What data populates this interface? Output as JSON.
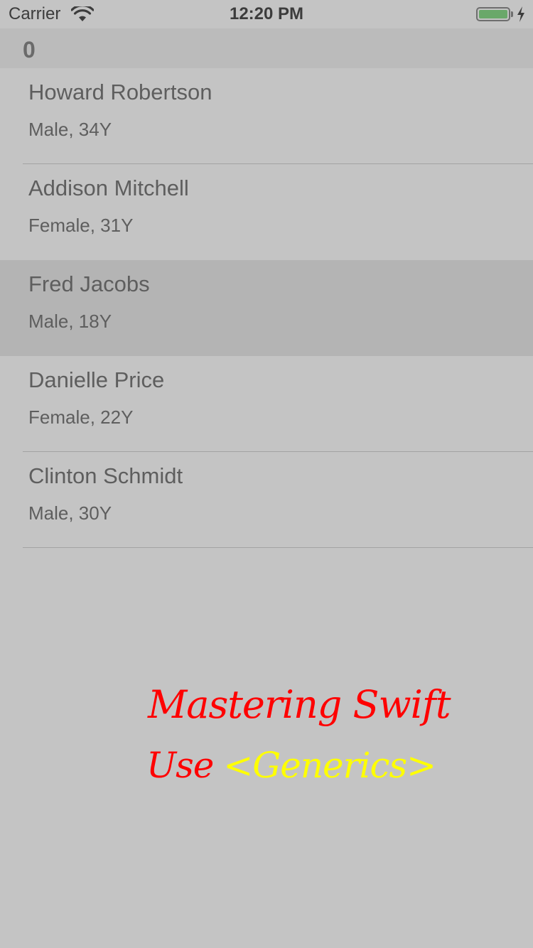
{
  "status_bar": {
    "carrier": "Carrier",
    "time": "12:20 PM",
    "battery_level": 1.0,
    "battery_color": "#6aa86a",
    "charging": true
  },
  "section": {
    "title": "0"
  },
  "people": [
    {
      "name": "Howard Robertson",
      "detail": "Male, 34Y",
      "selected": false
    },
    {
      "name": "Addison Mitchell",
      "detail": "Female, 31Y",
      "selected": false
    },
    {
      "name": "Fred Jacobs",
      "detail": "Male, 18Y",
      "selected": true
    },
    {
      "name": "Danielle Price",
      "detail": "Female, 22Y",
      "selected": false
    },
    {
      "name": "Clinton Schmidt",
      "detail": "Male, 30Y",
      "selected": false
    }
  ],
  "banner": {
    "line1": "Mastering Swift",
    "line2_prefix": "Use",
    "line2_highlight": "<Generics>",
    "line1_color": "#ff0000",
    "highlight_color": "#ffff00"
  },
  "colors": {
    "background": "#c4c4c4",
    "section_header": "#bbbbbb",
    "selected_row": "#b4b4b4",
    "text": "#5e5e5e"
  }
}
